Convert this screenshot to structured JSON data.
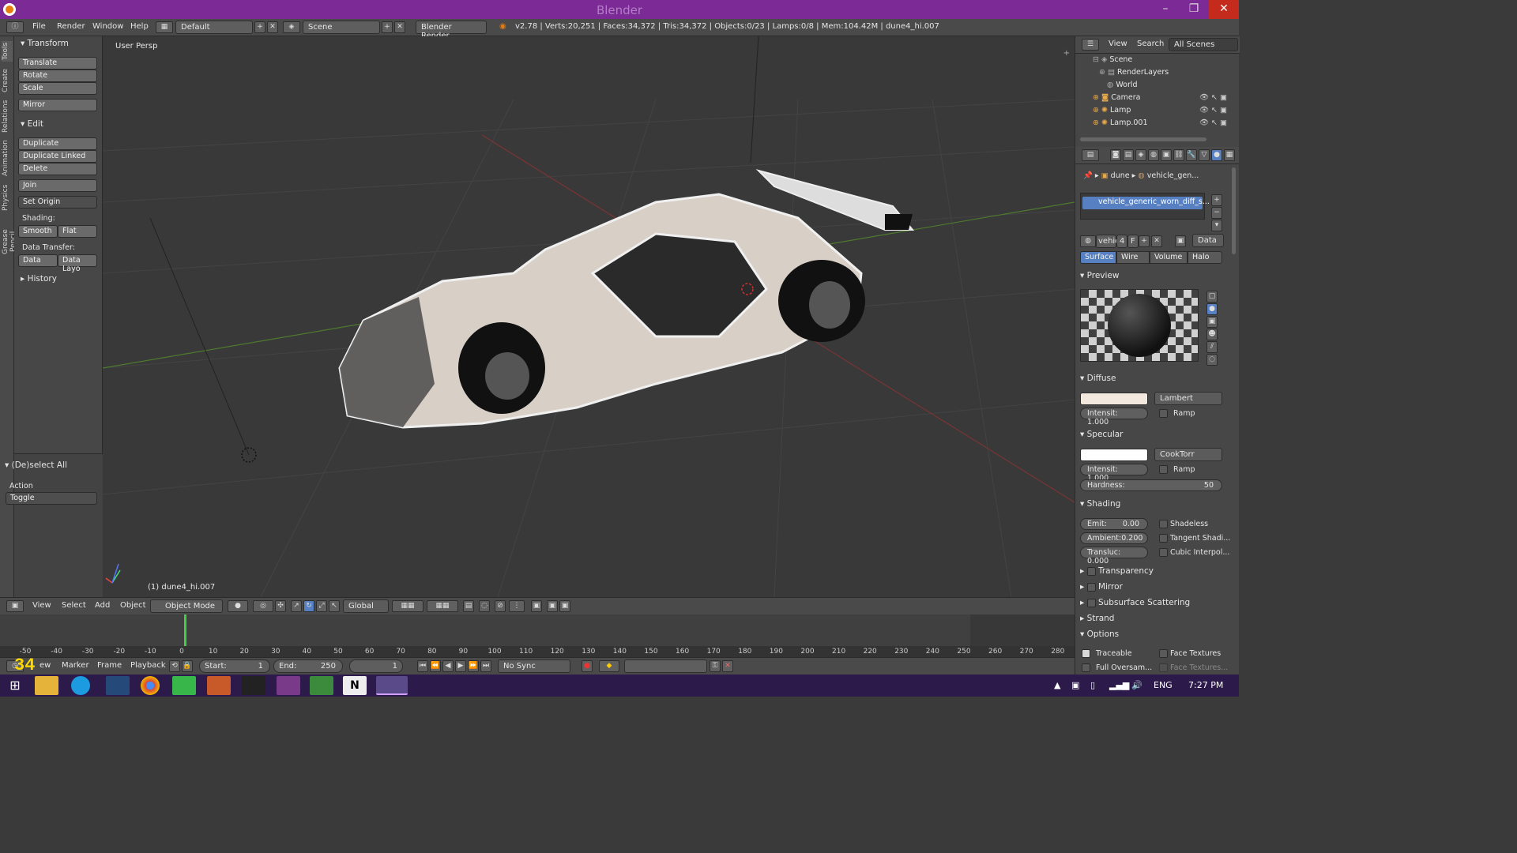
{
  "window": {
    "title": "Blender"
  },
  "topbar": {
    "menus": [
      "File",
      "Render",
      "Window",
      "Help"
    ],
    "layout": "Default",
    "scene": "Scene",
    "engine": "Blender Render",
    "stats": "v2.78 | Verts:20,251 | Faces:34,372 | Tris:34,372 | Objects:0/23 | Lamps:0/8 | Mem:104.42M | dune4_hi.007"
  },
  "tabs": [
    "Tools",
    "Create",
    "Relations",
    "Animation",
    "Physics",
    "Grease Pencil"
  ],
  "toolshelf": {
    "transform": {
      "title": "Transform",
      "buttons": [
        "Translate",
        "Rotate",
        "Scale",
        "Mirror"
      ]
    },
    "edit": {
      "title": "Edit",
      "buttons": [
        "Duplicate",
        "Duplicate Linked",
        "Delete",
        "Join",
        "Set Origin"
      ]
    },
    "shading_label": "Shading:",
    "shading": [
      "Smooth",
      "Flat"
    ],
    "data_transfer_label": "Data Transfer:",
    "data_transfer": [
      "Data",
      "Data Layo"
    ],
    "history": "History",
    "operator": {
      "title": "(De)select All",
      "action_label": "Action",
      "action_value": "Toggle"
    }
  },
  "viewport": {
    "label": "User Persp",
    "object_label": "(1) dune4_hi.007"
  },
  "header3d": {
    "menus": [
      "View",
      "Select",
      "Add",
      "Object"
    ],
    "mode": "Object Mode",
    "orientation": "Global"
  },
  "timeline": {
    "ticks": [
      "-50",
      "-40",
      "-30",
      "-20",
      "-10",
      "0",
      "10",
      "20",
      "30",
      "40",
      "50",
      "60",
      "70",
      "80",
      "90",
      "100",
      "110",
      "120",
      "130",
      "140",
      "150",
      "160",
      "170",
      "180",
      "190",
      "200",
      "210",
      "220",
      "230",
      "240",
      "250",
      "260",
      "270",
      "280"
    ],
    "menus": [
      "View",
      "Marker",
      "Frame",
      "Playback"
    ],
    "start_label": "Start:",
    "start": "1",
    "end_label": "End:",
    "end": "250",
    "current": "1",
    "sync": "No Sync",
    "frame_overlay": "34"
  },
  "outliner": {
    "menus": [
      "View",
      "Search"
    ],
    "filter": "All Scenes",
    "items": [
      "Scene",
      "RenderLayers",
      "World",
      "Camera",
      "Lamp",
      "Lamp.001"
    ]
  },
  "properties": {
    "breadcrumb": [
      "dune",
      "vehicle_gen..."
    ],
    "material_slot": "vehicle_generic_worn_diff_s...",
    "material_name": "vehic",
    "users": "4",
    "fake": "F",
    "link": "Data",
    "tabs": [
      "Surface",
      "Wire",
      "Volume",
      "Halo"
    ],
    "preview": "Preview",
    "diffuse": {
      "title": "Diffuse",
      "shader": "Lambert",
      "intensity": "Intensit: 1.000",
      "ramp": "Ramp",
      "color": "#f3e8de"
    },
    "specular": {
      "title": "Specular",
      "shader": "CookTorr",
      "intensity": "Intensit: 1.000",
      "ramp": "Ramp",
      "hardness_label": "Hardness:",
      "hardness": "50",
      "color": "#ffffff"
    },
    "shading": {
      "title": "Shading",
      "emit": "Emit:",
      "emit_value": "0.00",
      "ambient": "Ambient:0.200",
      "transluc": "Transluc: 0.000",
      "shadeless": "Shadeless",
      "tangent": "Tangent Shadi...",
      "cubic": "Cubic Interpol..."
    },
    "collapsed": [
      "Transparency",
      "Mirror",
      "Subsurface Scattering",
      "Strand"
    ],
    "options": {
      "title": "Options",
      "traceable": "Traceable",
      "face_textures": "Face Textures",
      "full_oversam": "Full Oversam...",
      "face_textures2": "Face Textures..."
    }
  },
  "taskbar": {
    "lang": "ENG",
    "time": "7:27 PM"
  },
  "colors": {
    "titlebar": "#7b2a96",
    "accent": "#5680c2",
    "taskbar": "#2b1a4a"
  }
}
